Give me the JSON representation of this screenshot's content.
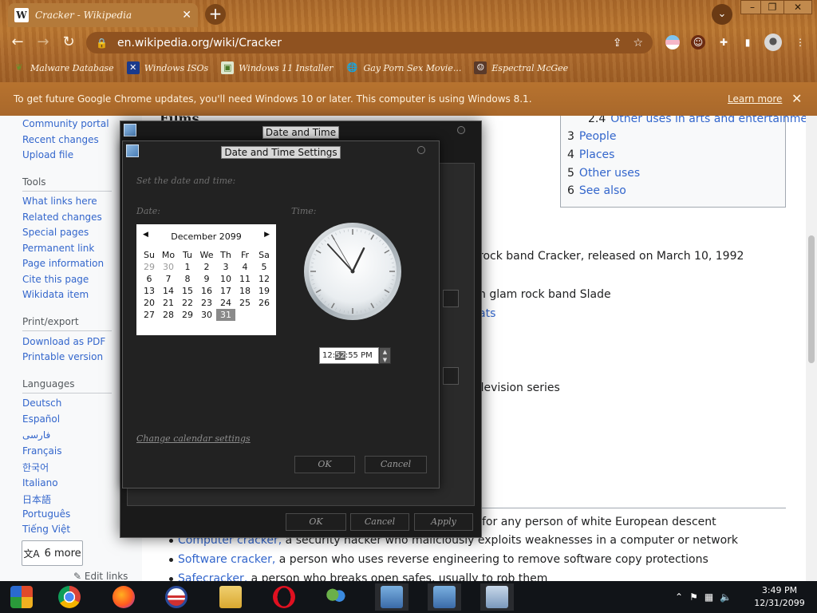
{
  "browser": {
    "tab_title": "Cracker - Wikipedia",
    "tab_favicon": "W",
    "url": "en.wikipedia.org/wiki/Cracker",
    "bookmarks": [
      {
        "label": "Malware Database",
        "icon": "leaf-icon"
      },
      {
        "label": "Windows ISOs",
        "icon": "x-icon"
      },
      {
        "label": "Windows 11 Installer",
        "icon": "photo-icon"
      },
      {
        "label": "Gay Porn Sex Movie...",
        "icon": "globe-icon"
      },
      {
        "label": "Espectral McGee",
        "icon": "avatar-icon"
      }
    ],
    "infobar_text": "To get future Google Chrome updates, you'll need Windows 10 or later. This computer is using Windows 8.1.",
    "infobar_link": "Learn more"
  },
  "wiki": {
    "sidebar": {
      "top_links": [
        "Community portal",
        "Recent changes",
        "Upload file"
      ],
      "tools_heading": "Tools",
      "tools_links": [
        "What links here",
        "Related changes",
        "Special pages",
        "Permanent link",
        "Page information",
        "Cite this page",
        "Wikidata item"
      ],
      "print_heading": "Print/export",
      "print_links": [
        "Download as PDF",
        "Printable version"
      ],
      "languages_heading": "Languages",
      "languages": [
        "Deutsch",
        "Español",
        "فارسی",
        "Français",
        "한국어",
        "Italiano",
        "日本語",
        "Português",
        "Tiếng Việt"
      ],
      "more_label": "6 more",
      "edit_links": "Edit links"
    },
    "partial_heading": "Films",
    "toc": [
      {
        "num": "2.4",
        "label": "Other uses in arts and entertainment"
      },
      {
        "num": "3",
        "label": "People"
      },
      {
        "num": "4",
        "label": "Places"
      },
      {
        "num": "5",
        "label": "Other uses"
      },
      {
        "num": "6",
        "label": "See also"
      }
    ],
    "frag1": "rock band Cracker, released on March 10, 1992",
    "frag2": "n glam rock band Slade",
    "frag3": "ats",
    "frag4": "elevision series",
    "frag5": "for any person of white European descent",
    "bullets": [
      {
        "link": "Computer cracker,",
        "text": " a security hacker who maliciously exploits weaknesses in a computer or network"
      },
      {
        "link": "Software cracker,",
        "text": " a person who uses reverse engineering to remove software copy protections"
      },
      {
        "link": "Safecracker,",
        "text": " a person who breaks open safes, usually to rob them"
      }
    ]
  },
  "dialog_outer": {
    "title": "Date and Time",
    "ok": "OK",
    "cancel": "Cancel",
    "apply": "Apply",
    "stub_label": "..."
  },
  "dialog_inner": {
    "title": "Date and Time Settings",
    "instruction": "Set the date and time:",
    "date_label": "Date:",
    "time_label": "Time:",
    "calendar": {
      "month": "December 2099",
      "weekdays": [
        "Su",
        "Mo",
        "Tu",
        "We",
        "Th",
        "Fr",
        "Sa"
      ],
      "weeks": [
        [
          "29",
          "30",
          "1",
          "2",
          "3",
          "4",
          "5"
        ],
        [
          "6",
          "7",
          "8",
          "9",
          "10",
          "11",
          "12"
        ],
        [
          "13",
          "14",
          "15",
          "16",
          "17",
          "18",
          "19"
        ],
        [
          "20",
          "21",
          "22",
          "23",
          "24",
          "25",
          "26"
        ],
        [
          "27",
          "28",
          "29",
          "30",
          "31",
          "",
          ""
        ]
      ],
      "selected_day": "31"
    },
    "time": {
      "hour": "12:",
      "minute": "52",
      "rest": ":55 PM"
    },
    "clock_hands": {
      "hour": 12,
      "minute": 52,
      "second": 55
    },
    "change_calendar": "Change calendar settings",
    "ok": "OK",
    "cancel": "Cancel"
  },
  "taskbar": {
    "apps": [
      "explorer-icon",
      "chrome-icon",
      "firefox-icon",
      "obama-icon",
      "file-explorer-icon",
      "opera-icon",
      "users-icon",
      "network-install-icon",
      "network-install-icon",
      "calendar-clock-icon"
    ],
    "time": "3:49 PM",
    "date": "12/31/2099"
  }
}
